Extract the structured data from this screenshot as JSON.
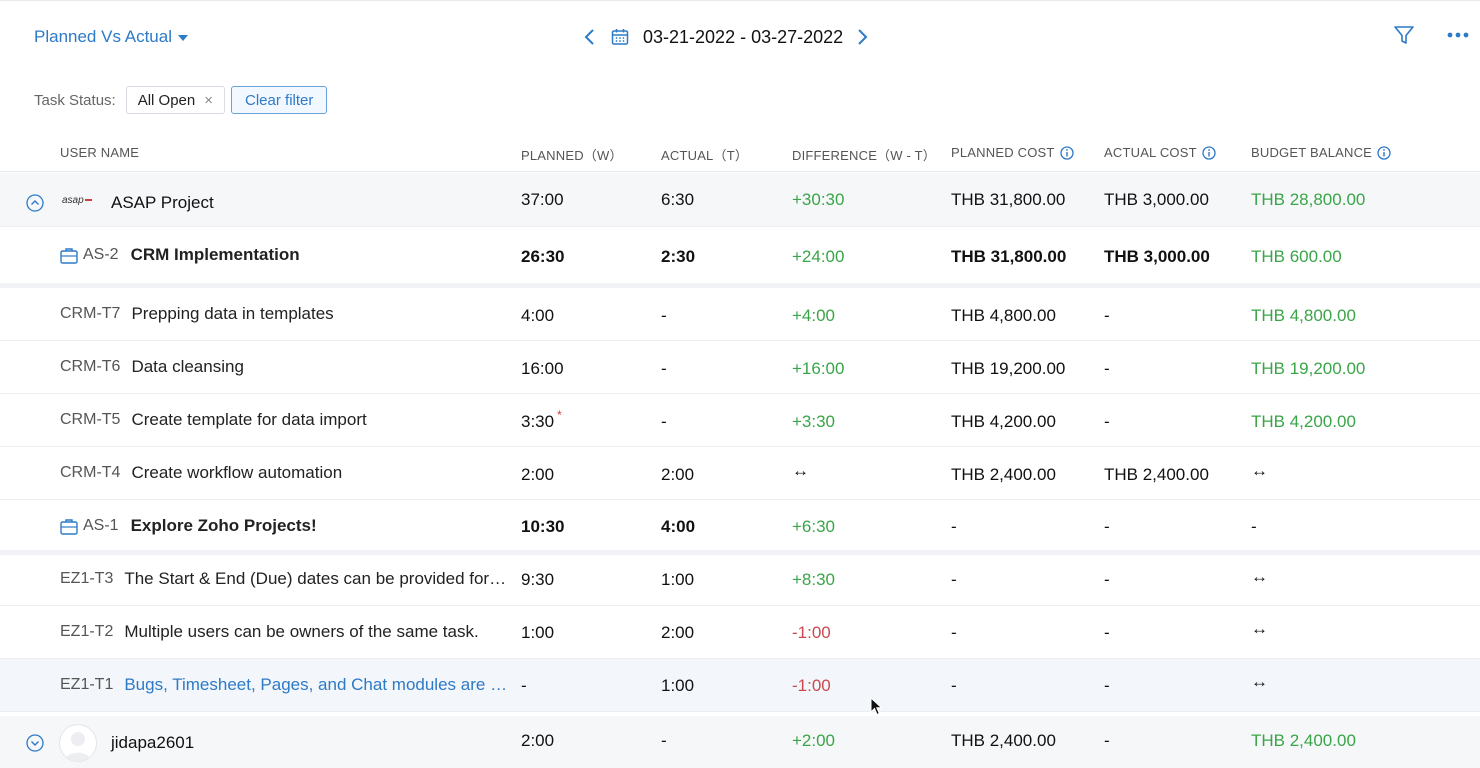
{
  "header": {
    "view_label": "Planned Vs Actual",
    "date_range": "03-21-2022 - 03-27-2022"
  },
  "filter": {
    "label": "Task Status:",
    "chip": "All Open",
    "chip_remove": "×",
    "clear_label": "Clear filter"
  },
  "columns": {
    "user_name": "USER NAME",
    "planned": "PLANNED（W）",
    "actual": "ACTUAL（T）",
    "difference": "DIFFERENCE（W - T）",
    "planned_cost": "PLANNED COST",
    "actual_cost": "ACTUAL COST",
    "budget_balance": "BUDGET BALANCE"
  },
  "project": {
    "logo_text": "asap",
    "name": "ASAP Project",
    "planned": "37:00",
    "actual": "6:30",
    "difference": "+30:30",
    "planned_cost": "THB 31,800.00",
    "actual_cost": "THB 3,000.00",
    "budget_balance": "THB 28,800.00"
  },
  "milestones": [
    {
      "id": "AS-2",
      "name": "CRM Implementation",
      "planned": "26:30",
      "actual": "2:30",
      "difference": "+24:00",
      "planned_cost": "THB 31,800.00",
      "actual_cost": "THB 3,000.00",
      "budget_balance": "THB 600.00"
    },
    {
      "id": "AS-1",
      "name": "Explore Zoho Projects!",
      "planned": "10:30",
      "actual": "4:00",
      "difference": "+6:30",
      "planned_cost": "-",
      "actual_cost": "-",
      "budget_balance": "-"
    }
  ],
  "tasks_crm": [
    {
      "id": "CRM-T7",
      "name": "Prepping data in templates",
      "planned": "4:00",
      "actual": "-",
      "difference": "+4:00",
      "planned_cost": "THB 4,800.00",
      "actual_cost": "-",
      "budget_balance": "THB 4,800.00"
    },
    {
      "id": "CRM-T6",
      "name": "Data cleansing",
      "planned": "16:00",
      "actual": "-",
      "difference": "+16:00",
      "planned_cost": "THB 19,200.00",
      "actual_cost": "-",
      "budget_balance": "THB 19,200.00"
    },
    {
      "id": "CRM-T5",
      "name": "Create template for data import",
      "planned": "3:30",
      "planned_marker": "*",
      "actual": "-",
      "difference": "+3:30",
      "planned_cost": "THB 4,200.00",
      "actual_cost": "-",
      "budget_balance": "THB 4,200.00"
    },
    {
      "id": "CRM-T4",
      "name": "Create workflow automation",
      "planned": "2:00",
      "actual": "2:00",
      "difference": "↔",
      "planned_cost": "THB 2,400.00",
      "actual_cost": "THB 2,400.00",
      "budget_balance": "↔"
    }
  ],
  "tasks_ez": [
    {
      "id": "EZ1-T3",
      "name": "The Start & End (Due) dates can be provided for t...",
      "planned": "9:30",
      "actual": "1:00",
      "difference": "+8:30",
      "planned_cost": "-",
      "actual_cost": "-",
      "budget_balance": "↔"
    },
    {
      "id": "EZ1-T2",
      "name": "Multiple users can be owners of the same task.",
      "planned": "1:00",
      "actual": "2:00",
      "difference": "-1:00",
      "planned_cost": "-",
      "actual_cost": "-",
      "budget_balance": "↔"
    },
    {
      "id": "EZ1-T1",
      "name": "Bugs, Timesheet, Pages, and Chat modules are not...",
      "planned": "-",
      "actual": "1:00",
      "difference": "-1:00",
      "planned_cost": "-",
      "actual_cost": "-",
      "budget_balance": "↔"
    }
  ],
  "user": {
    "name": "jidapa2601",
    "planned": "2:00",
    "actual": "-",
    "difference": "+2:00",
    "planned_cost": "THB 2,400.00",
    "actual_cost": "-",
    "budget_balance": "THB 2,400.00"
  },
  "colors": {
    "accent": "#2d7ac7",
    "positive": "#3aa548",
    "negative": "#c9494f",
    "group_row_bg": "#f6f7f9",
    "hover_row_bg": "#f3f6fa"
  },
  "icons": [
    "chevron-down-icon",
    "chevron-left-icon",
    "calendar-icon",
    "chevron-right-icon",
    "filter-icon",
    "more-icon",
    "info-icon",
    "collapse-icon",
    "expand-icon",
    "briefcase-icon",
    "avatar",
    "mouse-cursor-icon"
  ]
}
